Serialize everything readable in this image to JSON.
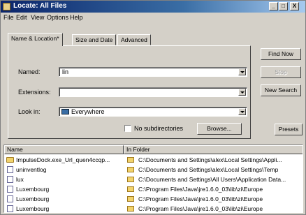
{
  "window": {
    "title": "Locate: All Files"
  },
  "titlebar": {
    "minimize": "_",
    "maximize": "□",
    "close": "X"
  },
  "menu": [
    "File",
    "Edit",
    "View",
    "Options",
    "Help"
  ],
  "tabs": [
    {
      "label": "Name & Location*"
    },
    {
      "label": "Size and Date"
    },
    {
      "label": "Advanced"
    }
  ],
  "form": {
    "named_label": "Named:",
    "named_value": "lin",
    "extensions_label": "Extensions:",
    "extensions_value": "",
    "lookin_label": "Look in:",
    "lookin_value": "Everywhere",
    "no_subdirs_label": "No subdirectories",
    "browse_label": "Browse..."
  },
  "buttons": {
    "find_now": "Find Now",
    "stop": "Stop",
    "new_search": "New Search",
    "presets": "Presets"
  },
  "results": {
    "columns": [
      "Name",
      "In Folder"
    ],
    "rows": [
      {
        "name": "ImpulseDock.exe_Url_quen4ccqp...",
        "folder": "C:\\Documents and Settings\\alex\\Local Settings\\Appli..."
      },
      {
        "name": "uninventlog",
        "folder": "C:\\Documents and Settings\\alex\\Local Settings\\Temp"
      },
      {
        "name": "lux",
        "folder": "C:\\Documents and Settings\\All Users\\Application Data..."
      },
      {
        "name": "Luxembourg",
        "folder": "C:\\Program Files\\Java\\jre1.6.0_03\\lib\\zi\\Europe"
      },
      {
        "name": "Luxembourg",
        "folder": "C:\\Program Files\\Java\\jre1.6.0_03\\lib\\zi\\Europe"
      },
      {
        "name": "Luxembourg",
        "folder": "C:\\Program Files\\Java\\jre1.6.0_03\\lib\\zi\\Europe"
      }
    ]
  }
}
